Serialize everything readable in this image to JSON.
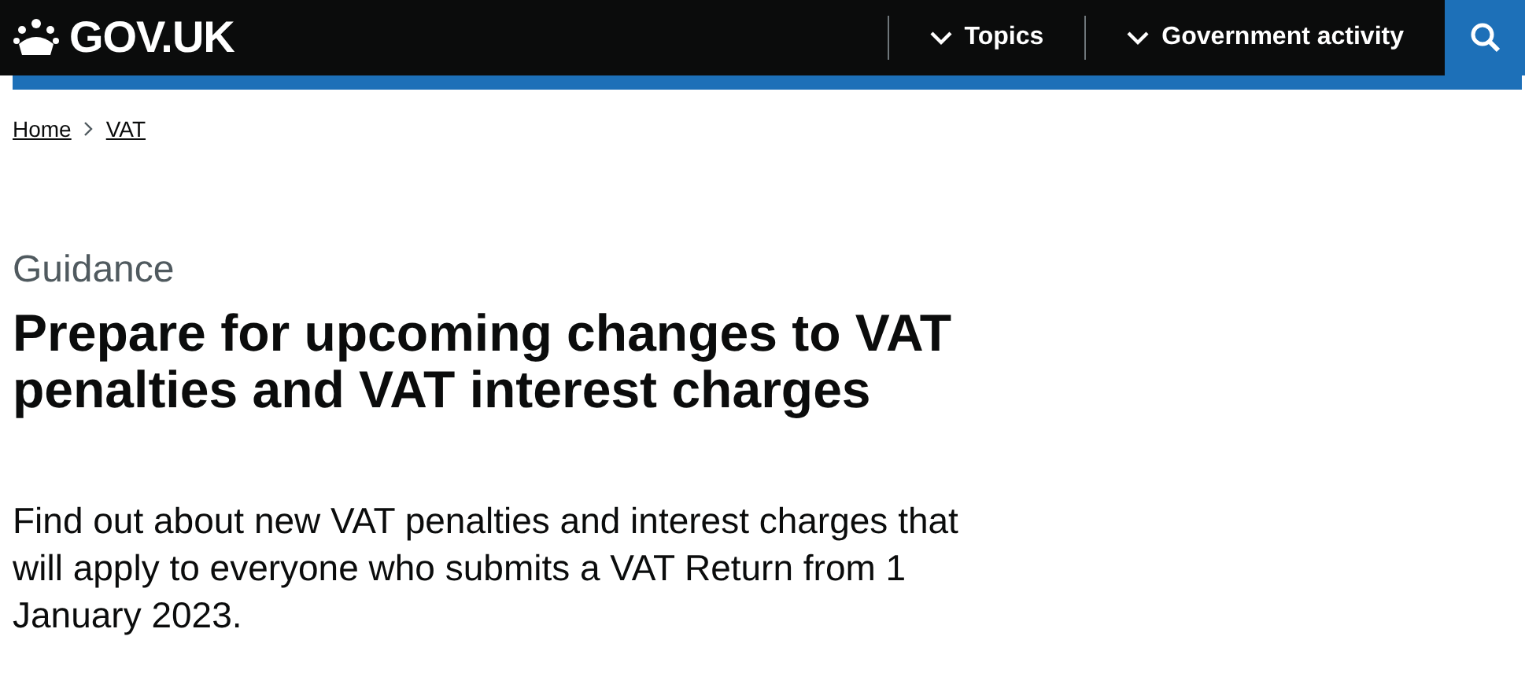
{
  "header": {
    "logo": "GOV.UK",
    "nav": [
      {
        "label": "Topics",
        "expanded": false
      },
      {
        "label": "Government activity",
        "expanded": false
      }
    ]
  },
  "breadcrumbs": [
    "Home",
    "VAT"
  ],
  "caption": "Guidance",
  "title": "Prepare for upcoming changes to VAT penalties and VAT interest charges",
  "description": "Find out about new VAT penalties and interest charges that will apply to everyone who submits a VAT Return from 1 January 2023."
}
